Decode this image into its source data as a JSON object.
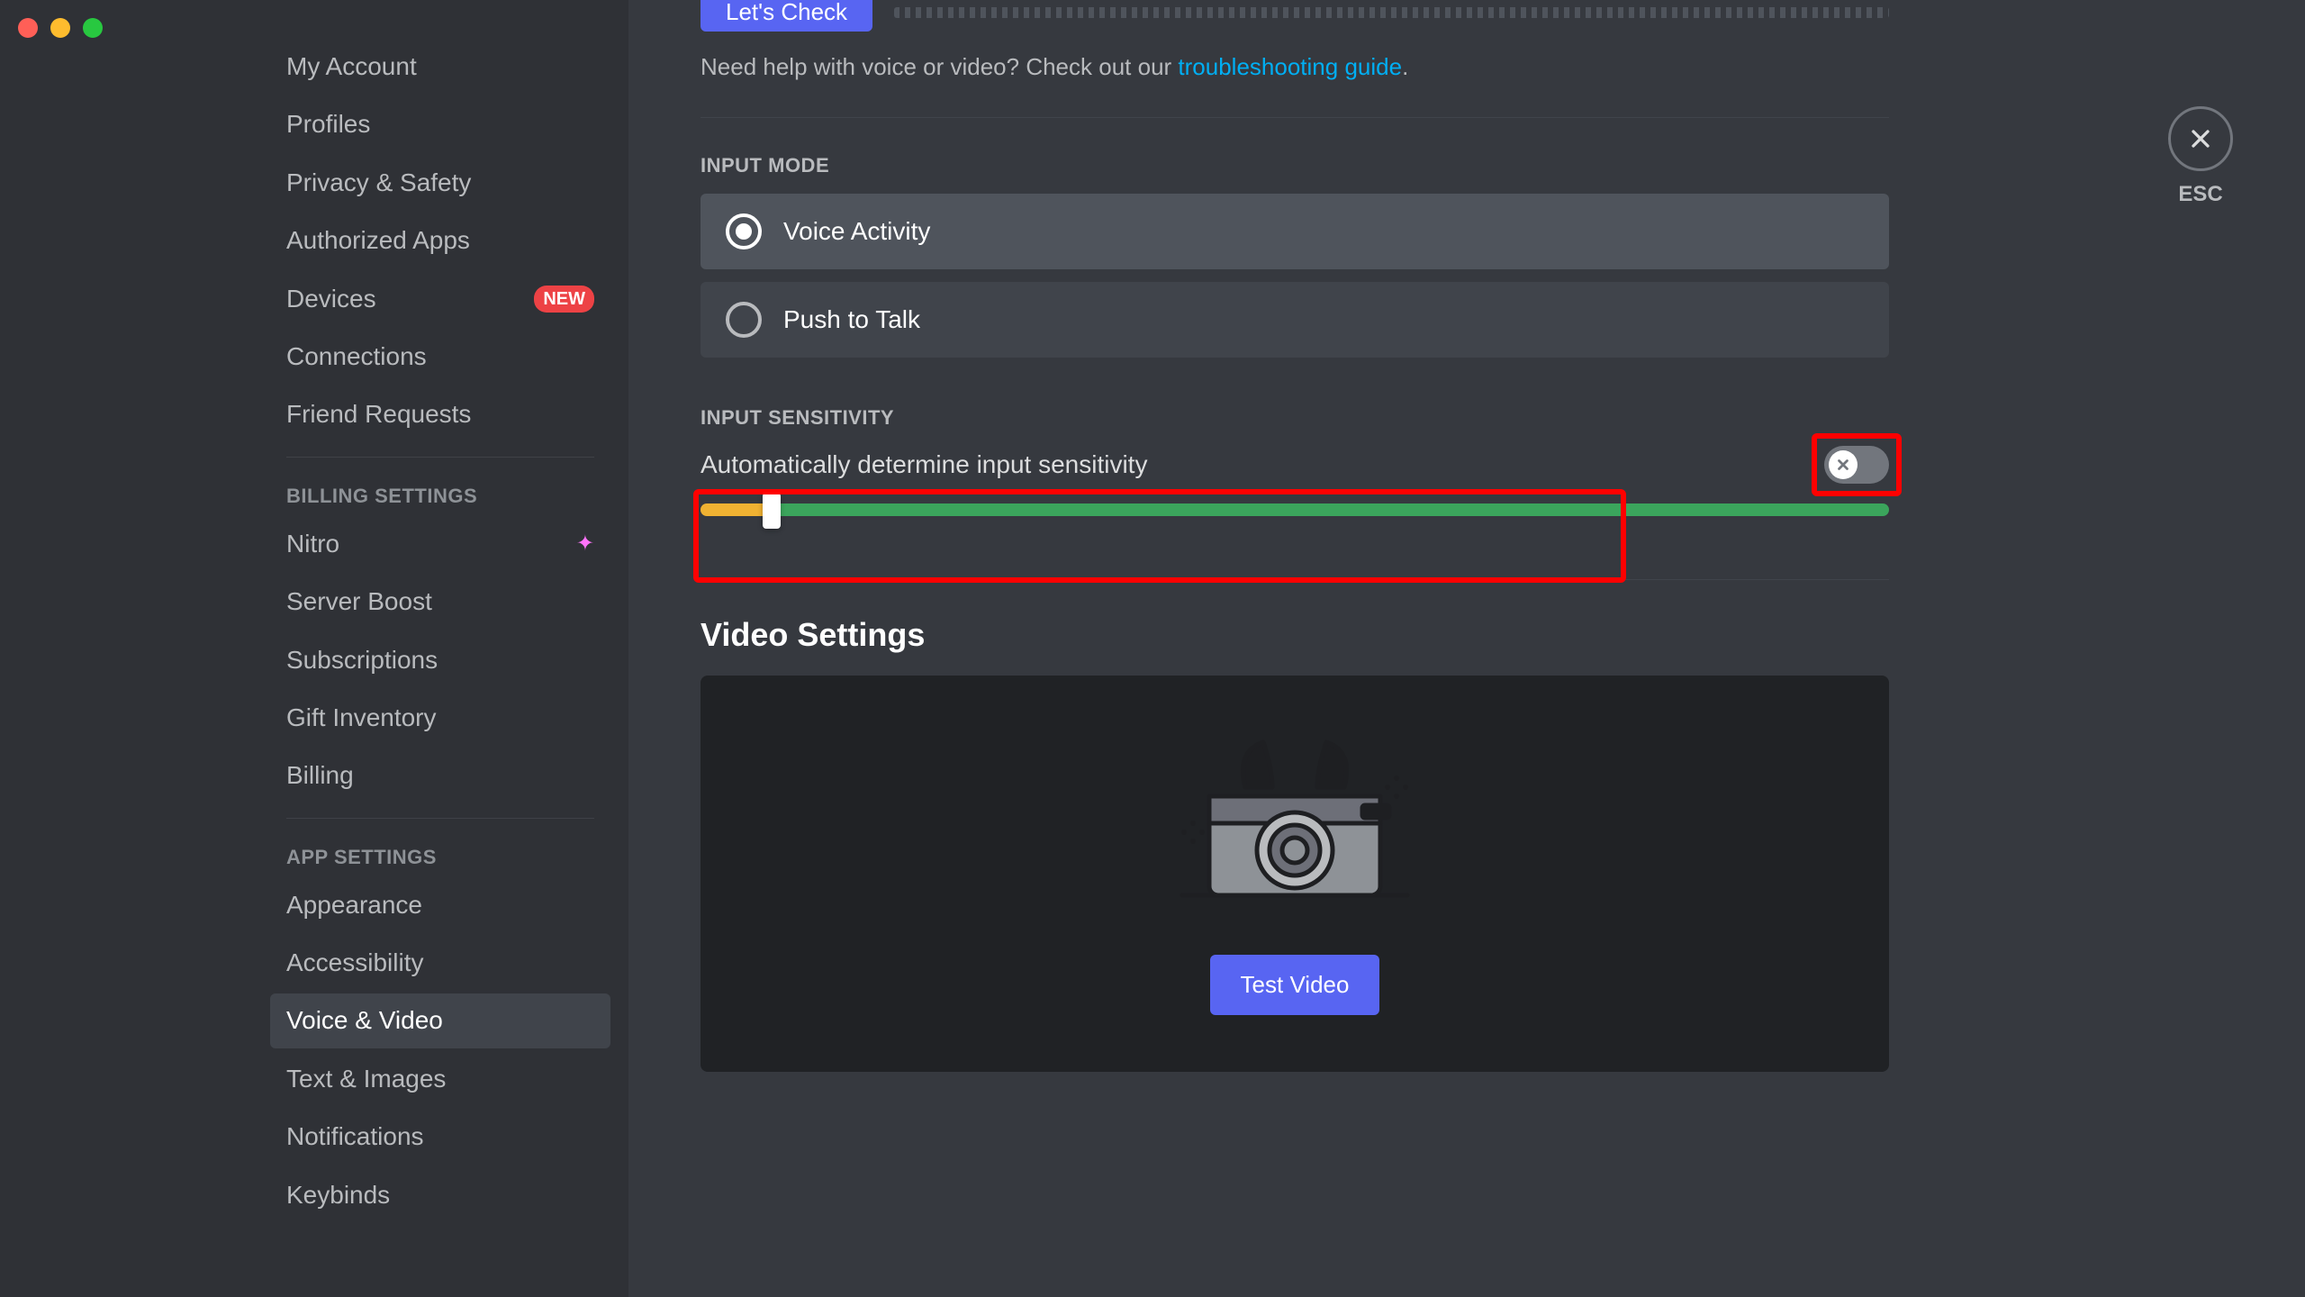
{
  "traffic_lights": [
    "close",
    "minimize",
    "zoom"
  ],
  "sidebar": {
    "user_settings_items": [
      {
        "label": "My Account"
      },
      {
        "label": "Profiles"
      },
      {
        "label": "Privacy & Safety"
      },
      {
        "label": "Authorized Apps"
      },
      {
        "label": "Devices",
        "badge": "NEW"
      },
      {
        "label": "Connections"
      },
      {
        "label": "Friend Requests"
      }
    ],
    "billing_header": "BILLING SETTINGS",
    "billing_items": [
      {
        "label": "Nitro",
        "icon": "nitro"
      },
      {
        "label": "Server Boost"
      },
      {
        "label": "Subscriptions"
      },
      {
        "label": "Gift Inventory"
      },
      {
        "label": "Billing"
      }
    ],
    "app_header": "APP SETTINGS",
    "app_items": [
      {
        "label": "Appearance"
      },
      {
        "label": "Accessibility"
      },
      {
        "label": "Voice & Video",
        "active": true
      },
      {
        "label": "Text & Images"
      },
      {
        "label": "Notifications"
      },
      {
        "label": "Keybinds"
      }
    ]
  },
  "content": {
    "lets_check": "Let's Check",
    "help_prefix": "Need help with voice or video? Check out our ",
    "help_link": "troubleshooting guide",
    "help_suffix": ".",
    "input_mode_label": "INPUT MODE",
    "input_mode_options": [
      {
        "label": "Voice Activity",
        "selected": true
      },
      {
        "label": "Push to Talk",
        "selected": false
      }
    ],
    "sensitivity_label": "INPUT SENSITIVITY",
    "auto_sens_label": "Automatically determine input sensitivity",
    "auto_sens_on": false,
    "slider_percent": 6,
    "video_settings_title": "Video Settings",
    "test_video_label": "Test Video",
    "close": {
      "esc": "ESC"
    }
  },
  "annotations": {
    "toggle_highlight": true,
    "slider_highlight": true
  }
}
